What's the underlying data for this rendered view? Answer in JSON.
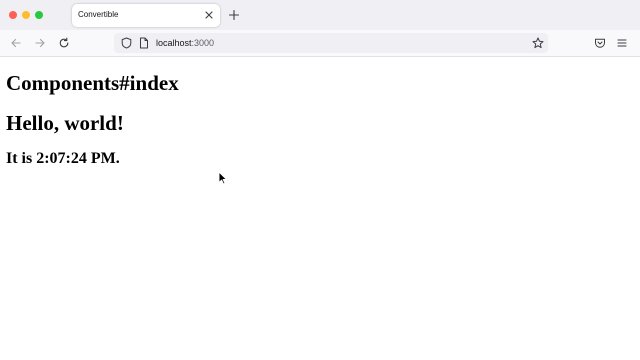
{
  "browser": {
    "tab": {
      "title": "Convertible"
    },
    "url": {
      "host": "localhost",
      "port": ":3000"
    }
  },
  "page": {
    "heading": "Components#index",
    "greeting": "Hello, world!",
    "time_text": "It is 2:07:24 PM."
  },
  "icons": {
    "traffic_lights": [
      "close",
      "minimize",
      "maximize"
    ],
    "nav": [
      "back-arrow-icon",
      "forward-arrow-icon",
      "reload-icon"
    ],
    "url": [
      "shield-icon",
      "page-icon",
      "star-icon"
    ],
    "toolbar": [
      "pocket-icon",
      "hamburger-menu-icon"
    ]
  },
  "colors": {
    "close": "#ff5f57",
    "minimize": "#febc2e",
    "maximize": "#28c840"
  }
}
